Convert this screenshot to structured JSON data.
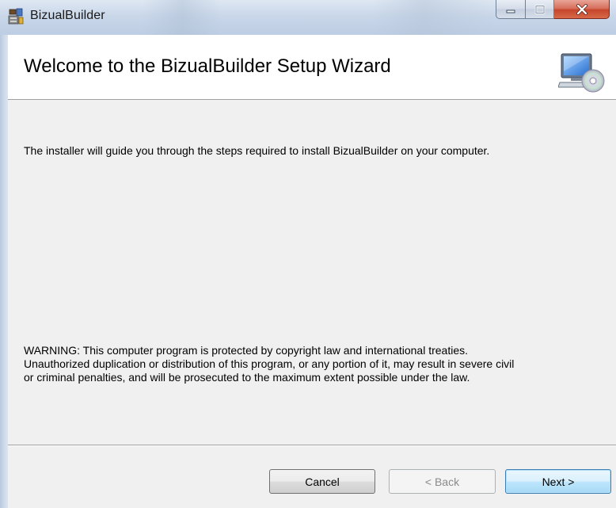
{
  "window": {
    "title": "BizualBuilder",
    "icon": "installer-app-icon"
  },
  "caption_buttons": {
    "minimize": "minimize-icon",
    "maximize": "maximize-icon",
    "close": "close-icon"
  },
  "header": {
    "title": "Welcome to the BizualBuilder Setup Wizard",
    "icon": "computer-cd-icon"
  },
  "body": {
    "intro": "The installer will guide you through the steps required to install BizualBuilder on your computer.",
    "warning_lines": [
      "WARNING: This computer program is protected by copyright law and international treaties.",
      "Unauthorized duplication or distribution of this program, or any portion of it, may result in severe civil",
      "or criminal penalties, and will be prosecuted to the maximum extent possible under the law."
    ]
  },
  "buttons": {
    "cancel": "Cancel",
    "back": "< Back",
    "next": "Next >"
  },
  "colors": {
    "title_bar": "#c9d7e9",
    "close_button": "#c7452d",
    "next_button_border": "#3c7fb1",
    "disabled_text": "#8a8a8a"
  }
}
